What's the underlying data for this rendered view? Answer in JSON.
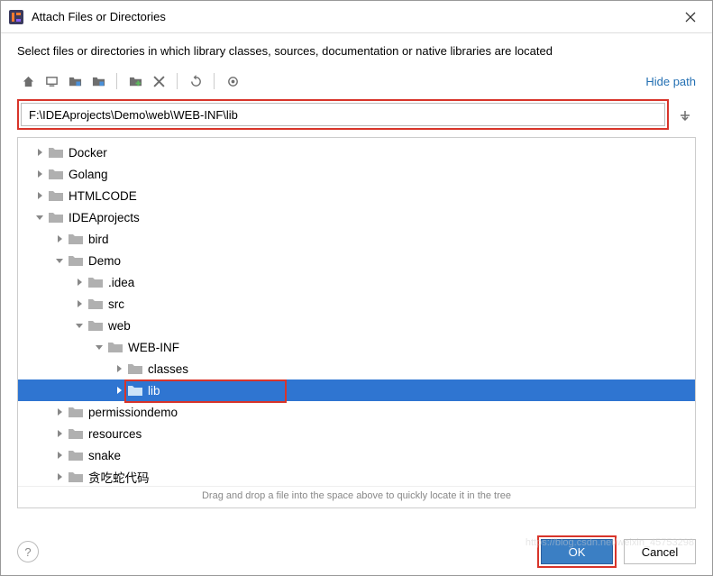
{
  "dialog": {
    "title": "Attach Files or Directories",
    "subtitle": "Select files or directories in which library classes, sources, documentation or native libraries are located",
    "hide_path": "Hide path",
    "path": "F:\\IDEAprojects\\Demo\\web\\WEB-INF\\lib",
    "drag_hint": "Drag and drop a file into the space above to quickly locate it in the tree",
    "ok": "OK",
    "cancel": "Cancel"
  },
  "tree": [
    {
      "label": "Docker",
      "depth": 0,
      "arrow": "right",
      "selected": false
    },
    {
      "label": "Golang",
      "depth": 0,
      "arrow": "right",
      "selected": false
    },
    {
      "label": "HTMLCODE",
      "depth": 0,
      "arrow": "right",
      "selected": false
    },
    {
      "label": "IDEAprojects",
      "depth": 0,
      "arrow": "down",
      "selected": false
    },
    {
      "label": "bird",
      "depth": 1,
      "arrow": "right",
      "selected": false
    },
    {
      "label": "Demo",
      "depth": 1,
      "arrow": "down",
      "selected": false
    },
    {
      "label": ".idea",
      "depth": 2,
      "arrow": "right",
      "selected": false
    },
    {
      "label": "src",
      "depth": 2,
      "arrow": "right",
      "selected": false
    },
    {
      "label": "web",
      "depth": 2,
      "arrow": "down",
      "selected": false
    },
    {
      "label": "WEB-INF",
      "depth": 3,
      "arrow": "down",
      "selected": false
    },
    {
      "label": "classes",
      "depth": 4,
      "arrow": "right",
      "selected": false
    },
    {
      "label": "lib",
      "depth": 4,
      "arrow": "right",
      "selected": true
    },
    {
      "label": "permissiondemo",
      "depth": 1,
      "arrow": "right",
      "selected": false
    },
    {
      "label": "resources",
      "depth": 1,
      "arrow": "right",
      "selected": false
    },
    {
      "label": "snake",
      "depth": 1,
      "arrow": "right",
      "selected": false
    },
    {
      "label": "贪吃蛇代码",
      "depth": 1,
      "arrow": "right",
      "selected": false
    }
  ],
  "watermark": "https://blog.csdn.net/weixin_45753298"
}
